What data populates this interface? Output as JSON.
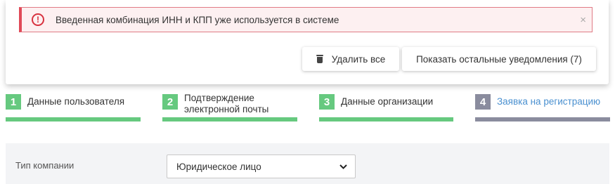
{
  "notification": {
    "error_message": "Введенная комбинация ИНН и КПП уже используется в системе",
    "close_glyph": "×",
    "alert_icon_glyph": "!",
    "delete_all_label": "Удалить все",
    "show_others_label": "Показать остальные уведомления (7)"
  },
  "steps": [
    {
      "number": "1",
      "label": "Данные пользователя",
      "state": "done"
    },
    {
      "number": "2",
      "label": "Подтверждение электронной почты",
      "state": "done"
    },
    {
      "number": "3",
      "label": "Данные организации",
      "state": "done"
    },
    {
      "number": "4",
      "label": "Заявка на регистрацию",
      "state": "current"
    }
  ],
  "form": {
    "company_type_label": "Тип компании",
    "company_type_value": "Юридическое лицо"
  },
  "colors": {
    "error": "#d8323f",
    "step_done": "#66c97f",
    "step_current": "#8a8c9e",
    "link_blue": "#4a90d0"
  }
}
